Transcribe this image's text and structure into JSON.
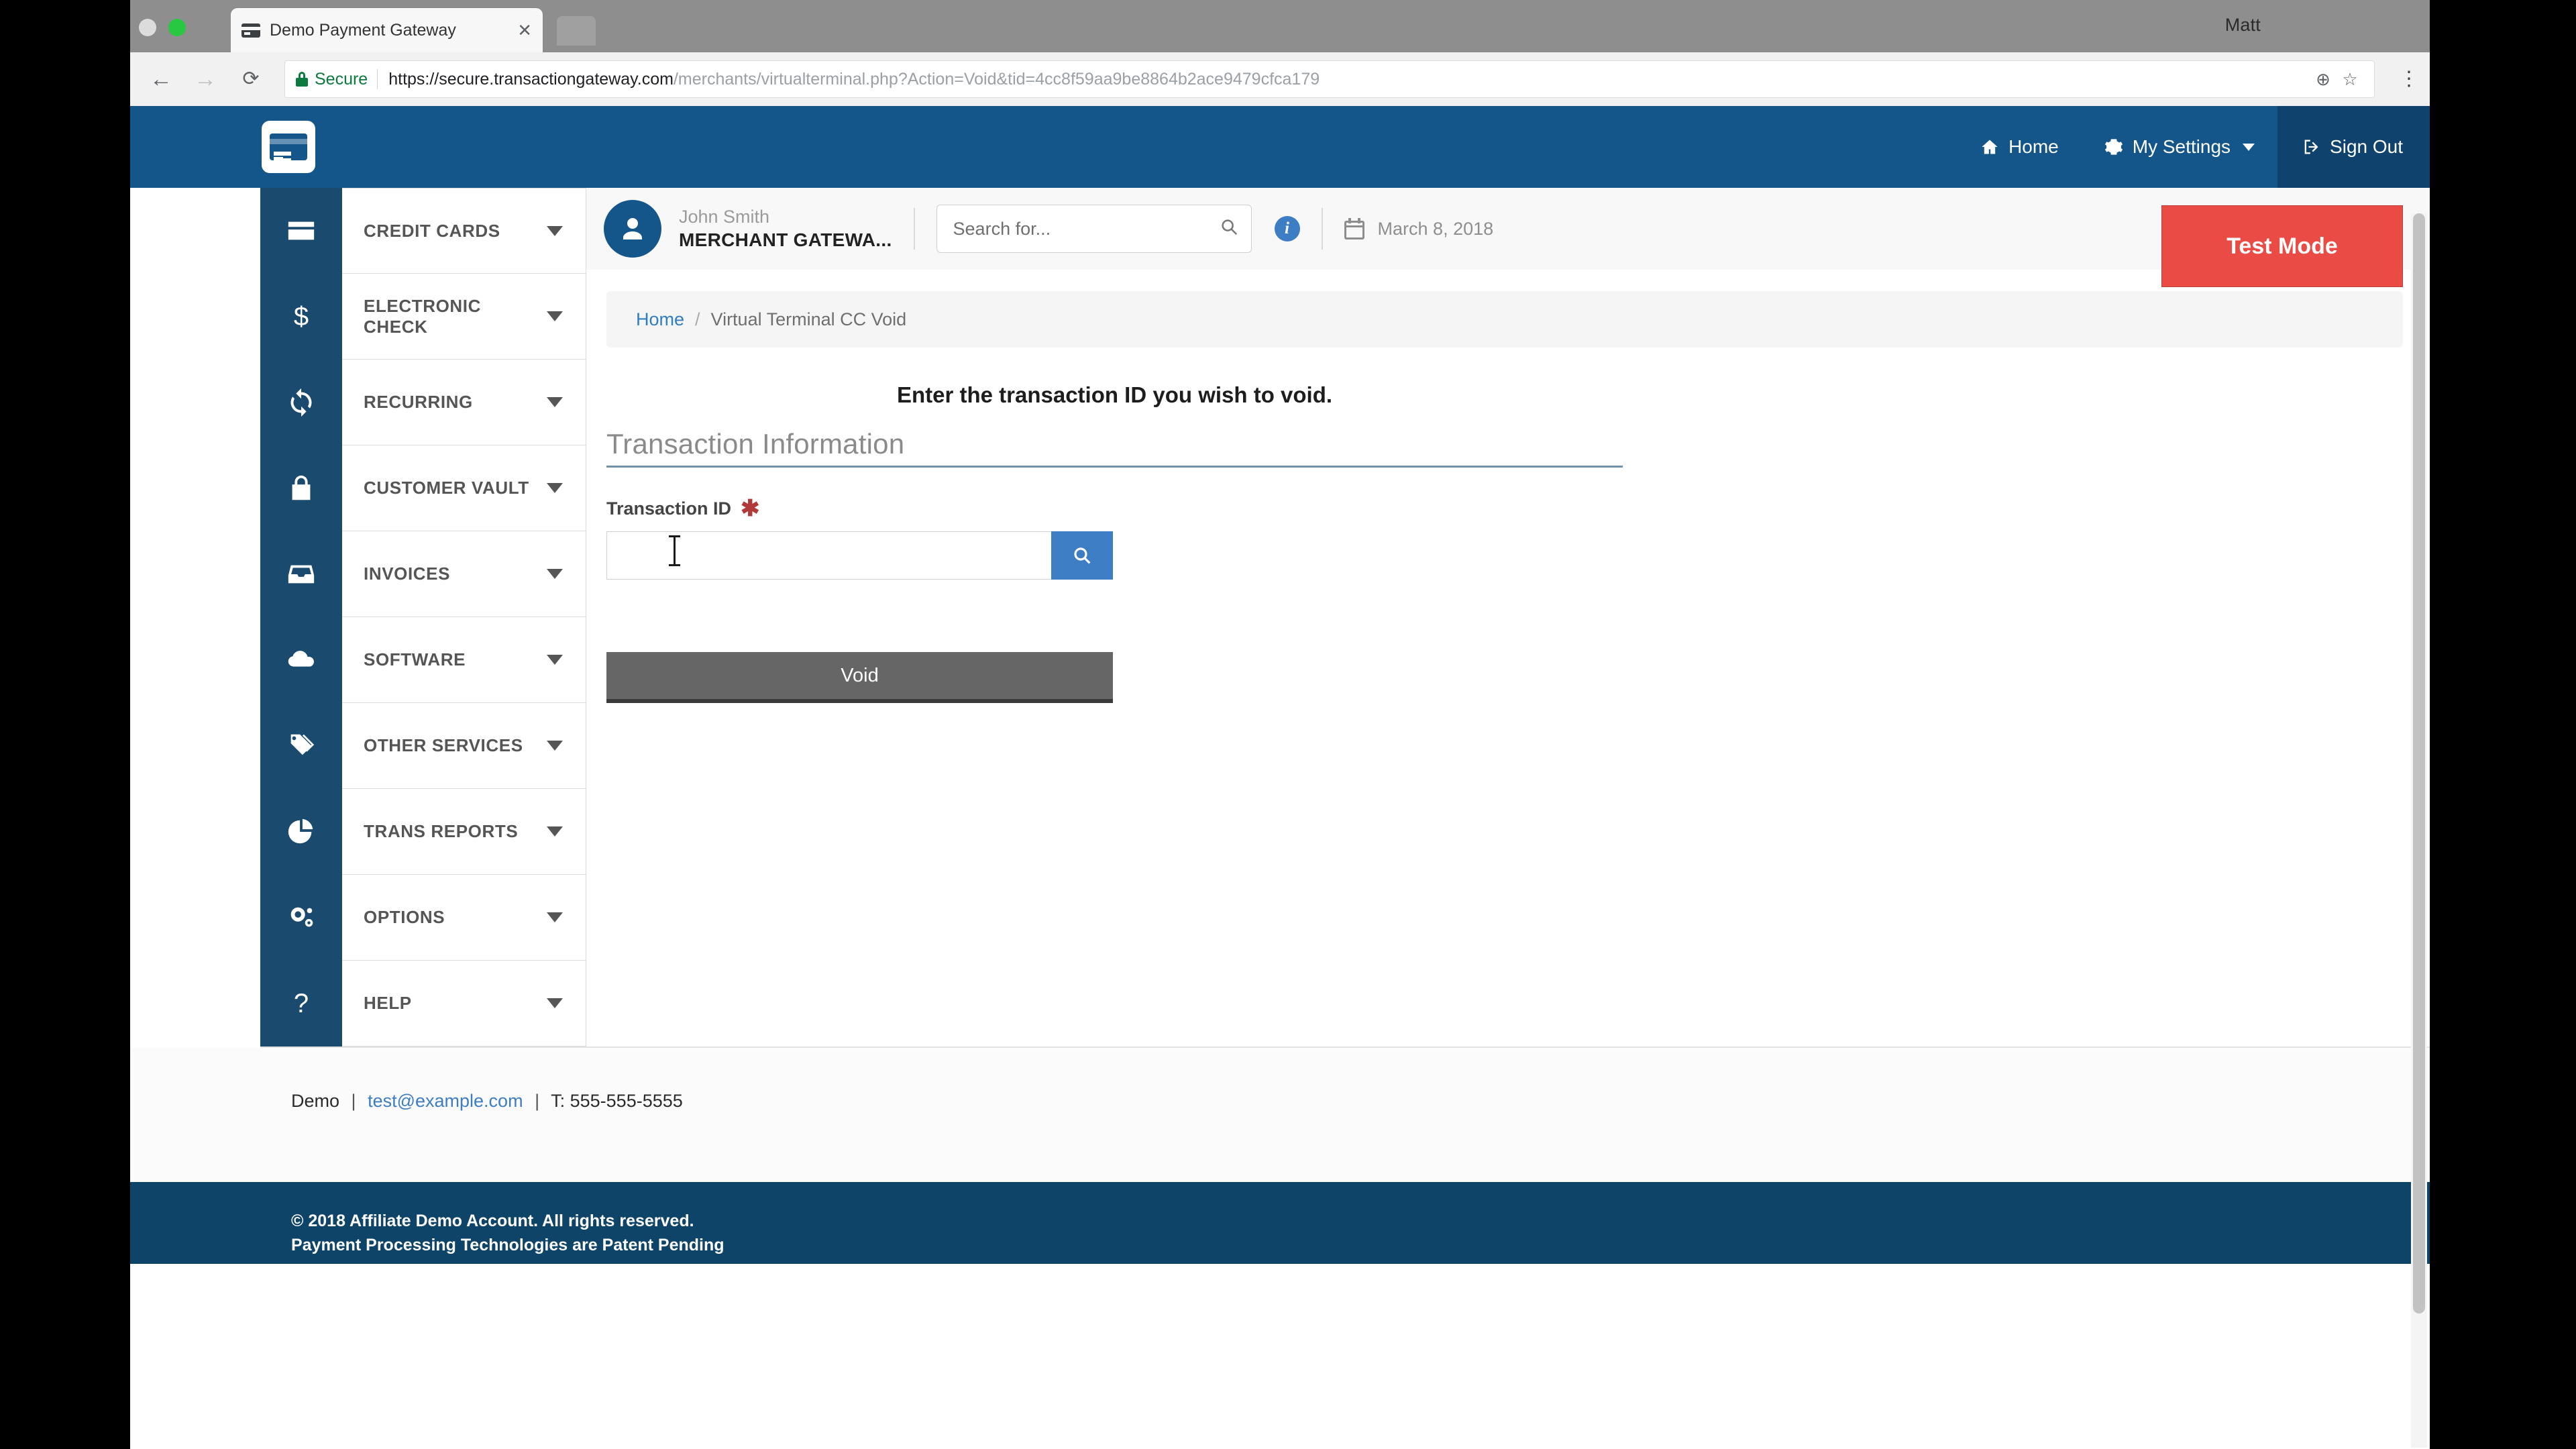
{
  "os": {
    "profile_name": "Matt"
  },
  "browser": {
    "tab_title": "Demo Payment Gateway",
    "tab_close": "✕",
    "back_icon": "←",
    "forward_icon": "→",
    "reload_icon": "⟳",
    "secure_label": "Secure",
    "url_scheme_host": "https://secure.transactiongateway.com",
    "url_path": "/merchants/virtualterminal.php?Action=Void&tid=4cc8f59aa9be8864b2ace9479cfca179",
    "zoom_icon": "⊕",
    "bookmark_icon": "☆",
    "menu_icon": "⋮"
  },
  "header": {
    "nav": [
      {
        "label": "Home",
        "icon": "home-icon"
      },
      {
        "label": "My Settings",
        "icon": "gear-icon"
      },
      {
        "label": "Sign Out",
        "icon": "sign-out-icon"
      }
    ]
  },
  "sidebar": {
    "items": [
      {
        "label": "CREDIT CARDS",
        "icon": "credit-card-icon"
      },
      {
        "label": "ELECTRONIC CHECK",
        "icon": "dollar-icon"
      },
      {
        "label": "RECURRING",
        "icon": "refresh-icon"
      },
      {
        "label": "CUSTOMER VAULT",
        "icon": "lock-icon"
      },
      {
        "label": "INVOICES",
        "icon": "inbox-icon"
      },
      {
        "label": "SOFTWARE",
        "icon": "cloud-icon"
      },
      {
        "label": "OTHER SERVICES",
        "icon": "tags-icon"
      },
      {
        "label": "TRANS REPORTS",
        "icon": "pie-chart-icon"
      },
      {
        "label": "OPTIONS",
        "icon": "gears-icon"
      },
      {
        "label": "HELP",
        "icon": "question-mark-icon"
      }
    ]
  },
  "user_strip": {
    "full_name": "John Smith",
    "merchant_name": "MERCHANT GATEWA...",
    "search_placeholder": "Search for...",
    "search_value": "",
    "info_icon_char": "i",
    "date": "March 8, 2018",
    "test_mode_label": "Test Mode"
  },
  "breadcrumb": {
    "home": "Home",
    "separator": "/",
    "current": "Virtual Terminal CC Void"
  },
  "main": {
    "instruction": "Enter the transaction ID you wish to void.",
    "section_title": "Transaction Information",
    "field_label": "Transaction ID",
    "required_marker": "✱",
    "tid_value": "",
    "tid_placeholder": "",
    "search_button_icon": "⌕",
    "submit_label": "Void"
  },
  "footer": {
    "company": "Demo",
    "email": "test@example.com",
    "phone": "T: 555-555-5555",
    "copyright": "© 2018 Affiliate Demo Account. All rights reserved.",
    "patent_line": "Payment Processing Technologies are Patent Pending"
  },
  "colors": {
    "header_blue": "#15568a",
    "sidebar_icon_navy": "#1a4a6e",
    "accent_blue": "#3d7dc4",
    "test_mode_red": "#ea4b44",
    "void_button_gray": "#666666",
    "footer_navy": "#0f4469",
    "link_blue": "#2f7ec4",
    "secure_green": "#0b7a3e"
  }
}
